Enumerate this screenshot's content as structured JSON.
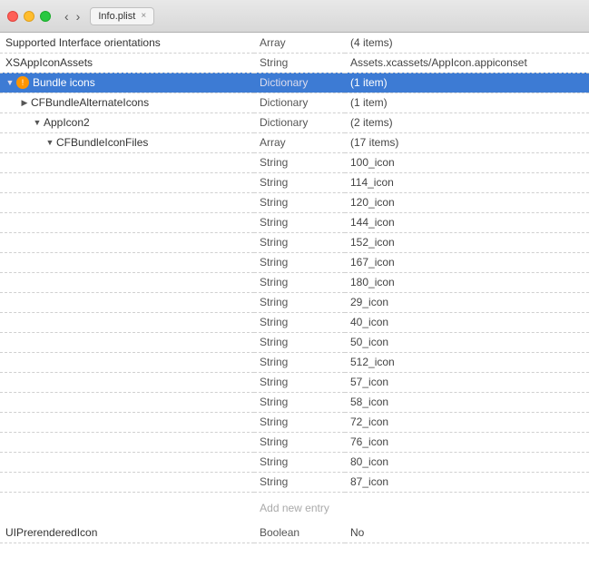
{
  "titlebar": {
    "filename": "Info.plist",
    "close_btn": "×"
  },
  "nav": {
    "back": "‹",
    "forward": "›"
  },
  "table": {
    "rows": [
      {
        "id": "supported-orientations",
        "indent": 0,
        "triangle": null,
        "key": "Supported Interface orientations",
        "type": "Array",
        "value": "(4 items)"
      },
      {
        "id": "xs-app-icon-assets",
        "indent": 0,
        "triangle": null,
        "key": "XSAppIconAssets",
        "type": "String",
        "value": "Assets.xcassets/AppIcon.appiconset"
      },
      {
        "id": "bundle-icons",
        "indent": 0,
        "triangle": "▼",
        "key": "Bundle icons",
        "type": "Dictionary",
        "value": "(1 item)",
        "selected": true,
        "badge": true
      },
      {
        "id": "cfbundle-alternate-icons",
        "indent": 1,
        "triangle": "▶",
        "key": "CFBundleAlternateIcons",
        "type": "Dictionary",
        "value": "(1 item)"
      },
      {
        "id": "appicon2",
        "indent": 2,
        "triangle": "▼",
        "key": "AppIcon2",
        "type": "Dictionary",
        "value": "(2 items)"
      },
      {
        "id": "cfbundle-icon-files",
        "indent": 3,
        "triangle": "▼",
        "key": "CFBundleIconFiles",
        "type": "Array",
        "value": "(17 items)"
      },
      {
        "id": "icon-100",
        "indent": 4,
        "triangle": null,
        "key": "",
        "type": "String",
        "value": "100_icon"
      },
      {
        "id": "icon-114",
        "indent": 4,
        "triangle": null,
        "key": "",
        "type": "String",
        "value": "114_icon"
      },
      {
        "id": "icon-120",
        "indent": 4,
        "triangle": null,
        "key": "",
        "type": "String",
        "value": "120_icon"
      },
      {
        "id": "icon-144",
        "indent": 4,
        "triangle": null,
        "key": "",
        "type": "String",
        "value": "144_icon"
      },
      {
        "id": "icon-152",
        "indent": 4,
        "triangle": null,
        "key": "",
        "type": "String",
        "value": "152_icon"
      },
      {
        "id": "icon-167",
        "indent": 4,
        "triangle": null,
        "key": "",
        "type": "String",
        "value": "167_icon"
      },
      {
        "id": "icon-180",
        "indent": 4,
        "triangle": null,
        "key": "",
        "type": "String",
        "value": "180_icon"
      },
      {
        "id": "icon-29",
        "indent": 4,
        "triangle": null,
        "key": "",
        "type": "String",
        "value": "29_icon"
      },
      {
        "id": "icon-40",
        "indent": 4,
        "triangle": null,
        "key": "",
        "type": "String",
        "value": "40_icon"
      },
      {
        "id": "icon-50",
        "indent": 4,
        "triangle": null,
        "key": "",
        "type": "String",
        "value": "50_icon"
      },
      {
        "id": "icon-512",
        "indent": 4,
        "triangle": null,
        "key": "",
        "type": "String",
        "value": "512_icon"
      },
      {
        "id": "icon-57",
        "indent": 4,
        "triangle": null,
        "key": "",
        "type": "String",
        "value": "57_icon"
      },
      {
        "id": "icon-58",
        "indent": 4,
        "triangle": null,
        "key": "",
        "type": "String",
        "value": "58_icon"
      },
      {
        "id": "icon-72",
        "indent": 4,
        "triangle": null,
        "key": "",
        "type": "String",
        "value": "72_icon"
      },
      {
        "id": "icon-76",
        "indent": 4,
        "triangle": null,
        "key": "",
        "type": "String",
        "value": "76_icon"
      },
      {
        "id": "icon-80",
        "indent": 4,
        "triangle": null,
        "key": "",
        "type": "String",
        "value": "80_icon"
      },
      {
        "id": "icon-87",
        "indent": 4,
        "triangle": null,
        "key": "",
        "type": "String",
        "value": "87_icon"
      }
    ],
    "add_entry_label": "Add new entry",
    "footer_row": {
      "key": "UIPrerenderedIcon",
      "type": "Boolean",
      "value": "No"
    }
  },
  "colors": {
    "selected_bg": "#3d7bd4",
    "selected_text": "#ffffff",
    "dashed_border": "#d0d0d0"
  }
}
